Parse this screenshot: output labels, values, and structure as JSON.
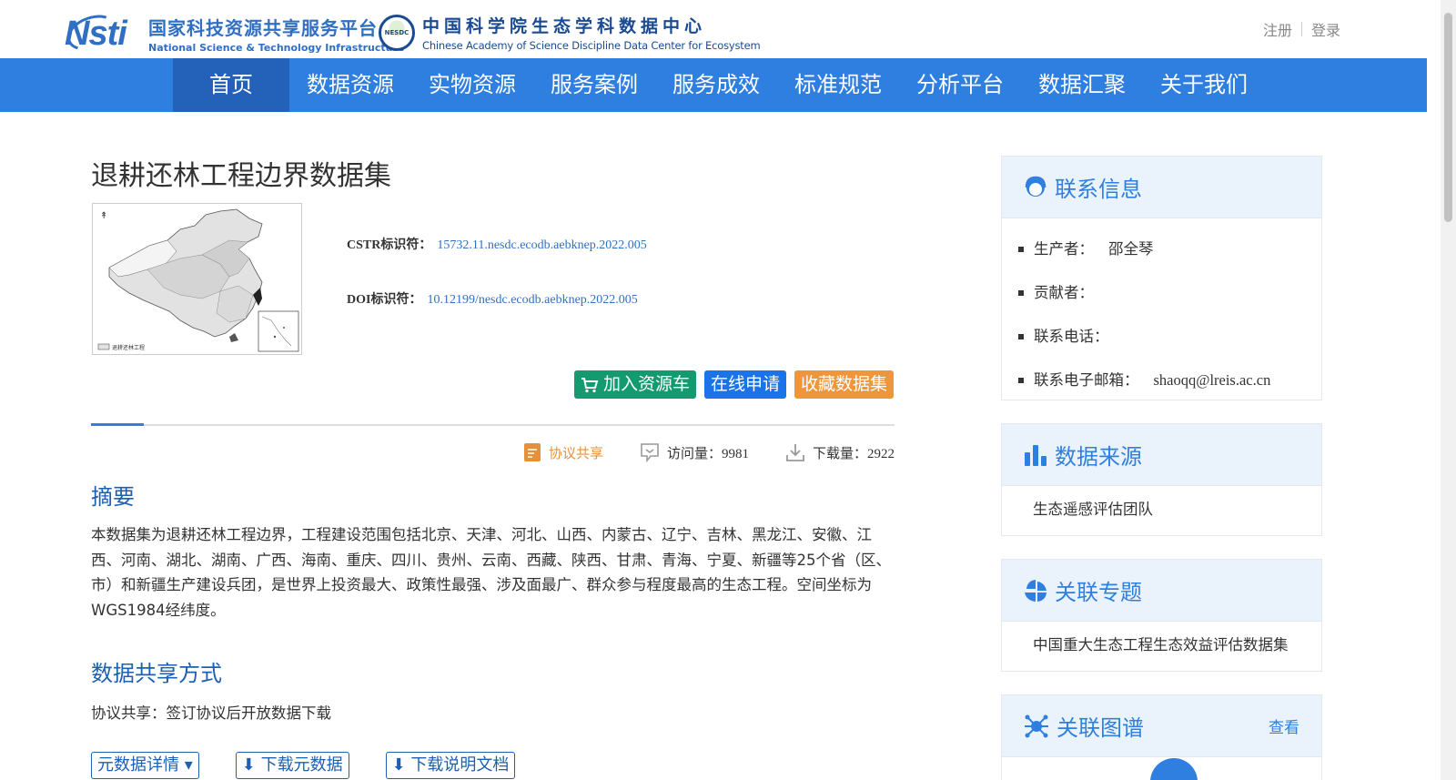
{
  "header": {
    "logo1_cn": "国家科技资源共享服务平台",
    "logo1_en": "National Science & Technology Infrastructure",
    "logo1_mark": "Nsti",
    "logo2_badge": "NESDC",
    "logo2_cn": "中国科学院生态学科数据中心",
    "logo2_en": "Chinese Academy of Science Discipline Data Center for Ecosystem",
    "register": "注册",
    "login": "登录"
  },
  "nav": [
    "首页",
    "数据资源",
    "实物资源",
    "服务案例",
    "服务成效",
    "标准规范",
    "分析平台",
    "数据汇聚",
    "关于我们"
  ],
  "dataset": {
    "title": "退耕还林工程边界数据集",
    "cstr_label": "CSTR标识符：",
    "cstr_value": "15732.11.nesdc.ecodb.aebknep.2022.005",
    "doi_label": "DOI标识符：",
    "doi_value": "10.12199/nesdc.ecodb.aebknep.2022.005",
    "btn_cart": "加入资源车",
    "btn_apply": "在线申请",
    "btn_fav": "收藏数据集",
    "share_type": "协议共享",
    "visits": "访问量：9981",
    "downloads": "下载量：2922",
    "abstract_heading": "摘要",
    "abstract": "本数据集为退耕还林工程边界，工程建设范围包括北京、天津、河北、山西、内蒙古、辽宁、吉林、黑龙江、安徽、江西、河南、湖北、湖南、广西、海南、重庆、四川、贵州、云南、西藏、陕西、甘肃、青海、宁夏、新疆等25个省（区、市）和新疆生产建设兵团，是世界上投资最大、政策性最强、涉及面最广、群众参与程度最高的生态工程。空间坐标为WGS1984经纬度。",
    "sharing_heading": "数据共享方式",
    "sharing_text": "协议共享：签订协议后开放数据下载",
    "dl_details": "元数据详情 ▾",
    "dl_meta": "⬇ 下载元数据",
    "dl_doc": "⬇ 下载说明文档",
    "map_legend": "退耕还林工程"
  },
  "sidebar": {
    "contact_title": "联系信息",
    "producer_label": "生产者：",
    "producer_value": "邵全琴",
    "contributor_label": "贡献者：",
    "phone_label": "联系电话：",
    "email_label": "联系电子邮箱：",
    "email_value": "shaoqq@lreis.ac.cn",
    "source_title": "数据来源",
    "source_value": "生态遥感评估团队",
    "topic_title": "关联专题",
    "topic_value": "中国重大生态工程生态效益评估数据集",
    "graph_title": "关联图谱",
    "graph_more": "查看"
  },
  "colors": {
    "nav": "#2f7fe0",
    "nav_active": "#2461b8",
    "green": "#139b6f",
    "blue": "#1a73e8",
    "orange": "#f0963a"
  }
}
